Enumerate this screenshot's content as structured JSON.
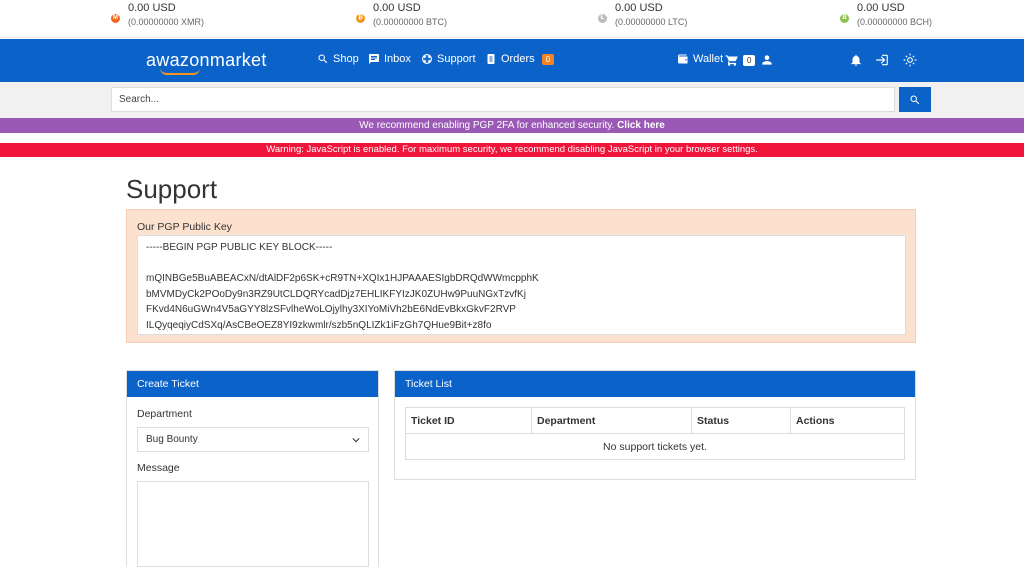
{
  "ticker": [
    {
      "usd": "0.00 USD",
      "amount": "(0.00000000 XMR)",
      "color": "#f26822"
    },
    {
      "usd": "0.00 USD",
      "amount": "(0.00000000 BTC)",
      "color": "#f7931a"
    },
    {
      "usd": "0.00 USD",
      "amount": "(0.00000000 LTC)",
      "color": "#bfbbbb"
    },
    {
      "usd": "0.00 USD",
      "amount": "(0.00000000 BCH)",
      "color": "#8dc351"
    }
  ],
  "nav": {
    "brand": "awazonmarket",
    "shop": "Shop",
    "inbox": "Inbox",
    "support": "Support",
    "orders": "Orders",
    "orders_count": "0",
    "wallet": "Wallet",
    "cart_count": "0"
  },
  "search": {
    "placeholder": "Search..."
  },
  "banners": {
    "pgp_text": "We recommend enabling PGP 2FA for enhanced security.",
    "pgp_link": "Click here",
    "js_warning": "Warning: JavaScript is enabled. For maximum security, we recommend disabling JavaScript in your browser settings."
  },
  "page": {
    "title": "Support",
    "pgp_label": "Our PGP Public Key",
    "pgp_key": "-----BEGIN PGP PUBLIC KEY BLOCK-----\n\nmQINBGe5BuABEACxN/dtAlDF2p6SK+cR9TN+XQIx1HJPAAAESIgbDRQdWWmcpphK\nbMVMDyCk2POoDy9n3RZ9UtCLDQRYcadDjz7EHLIKFYIzJK0ZUHw9PuuNGxTzvfKj\nFKvd4N6uGWn4V5aGYY8lzSFvlheWoLOjylhy3XIYoMiVh2bE6NdEvBkxGkvF2RVP\nILQyqeqiyCdSXq/AsCBeOEZ8YI9zkwmlr/szb5nQLIZk1iFzGh7QHue9Bit+z8fo"
  },
  "create_ticket": {
    "header": "Create Ticket",
    "department_label": "Department",
    "department_value": "Bug Bounty",
    "message_label": "Message"
  },
  "ticket_list": {
    "header": "Ticket List",
    "columns": [
      "Ticket ID",
      "Department",
      "Status",
      "Actions"
    ],
    "empty": "No support tickets yet."
  }
}
